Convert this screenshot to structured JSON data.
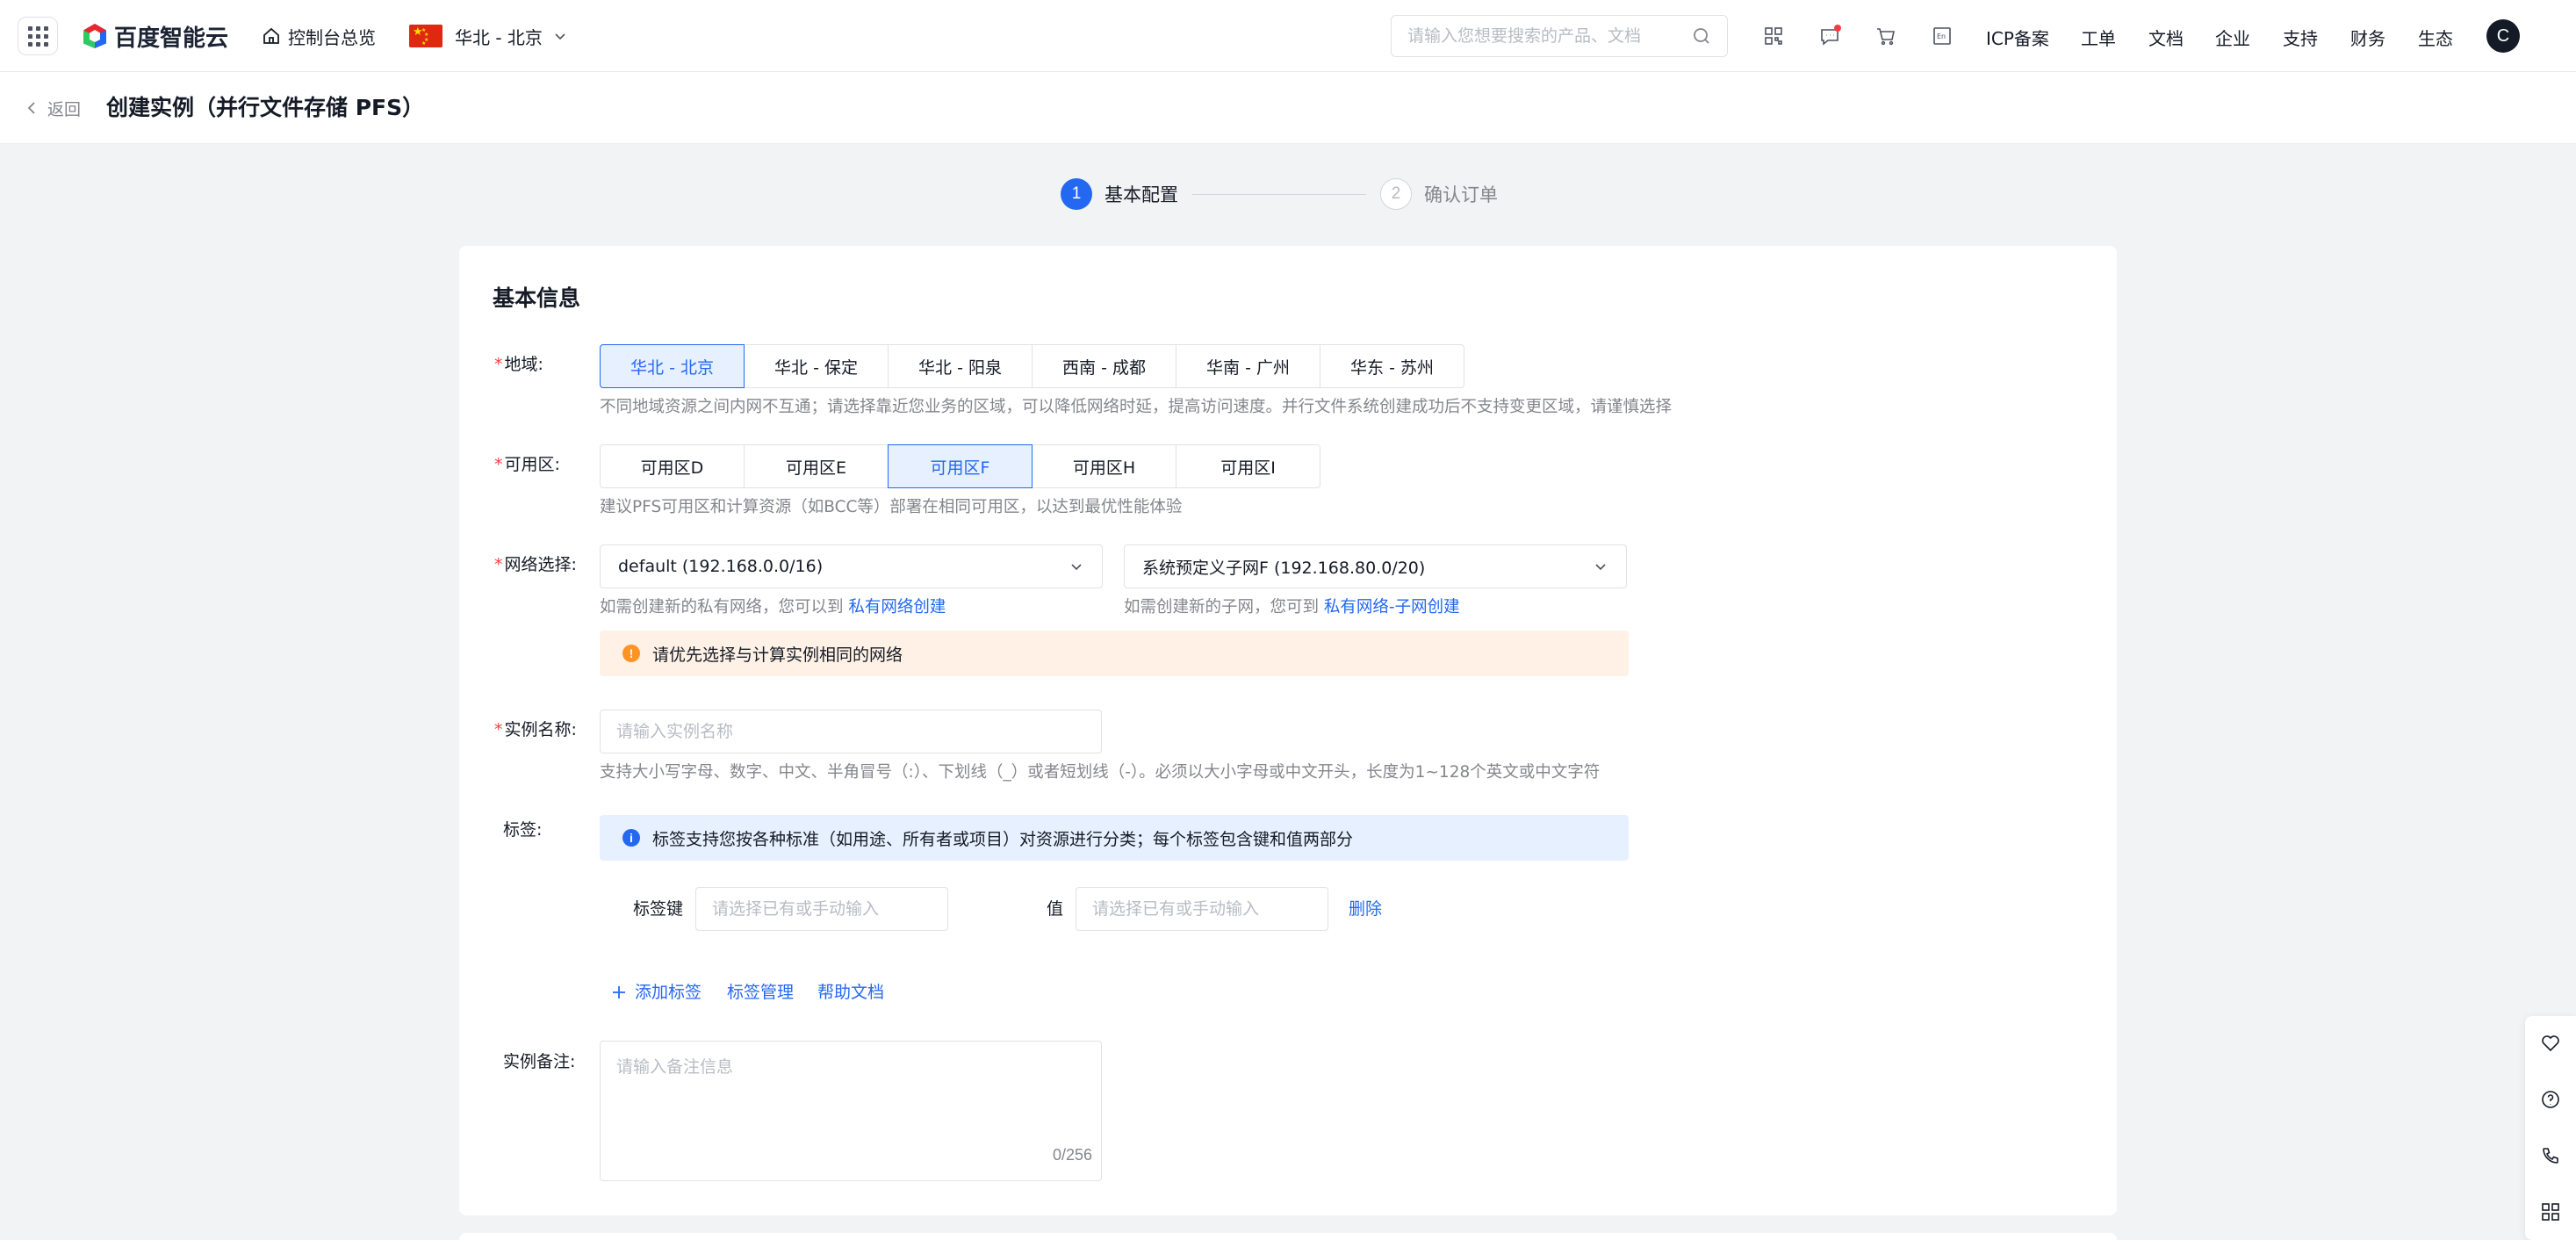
{
  "header": {
    "brand": "百度智能云",
    "console_home": "控制台总览",
    "region": "华北 - 北京",
    "search_placeholder": "请输入您想要搜索的产品、文档",
    "nav": [
      "ICP备案",
      "工单",
      "文档",
      "企业",
      "支持",
      "财务",
      "生态"
    ],
    "avatar_letter": "C"
  },
  "titlebar": {
    "back": "返回",
    "title": "创建实例（并行文件存储 PFS）"
  },
  "steps": [
    {
      "num": "1",
      "label": "基本配置"
    },
    {
      "num": "2",
      "label": "确认订单"
    }
  ],
  "form": {
    "section_title": "基本信息",
    "region": {
      "label": "地域:",
      "options": [
        "华北 - 北京",
        "华北 - 保定",
        "华北 - 阳泉",
        "西南 - 成都",
        "华南 - 广州",
        "华东 - 苏州"
      ],
      "selected": "华北 - 北京",
      "hint": "不同地域资源之间内网不互通；请选择靠近您业务的区域，可以降低网络时延，提高访问速度。并行文件系统创建成功后不支持变更区域，请谨慎选择"
    },
    "zone": {
      "label": "可用区:",
      "options": [
        "可用区D",
        "可用区E",
        "可用区F",
        "可用区H",
        "可用区I"
      ],
      "selected": "可用区F",
      "hint": "建议PFS可用区和计算资源（如BCC等）部署在相同可用区，以达到最优性能体验"
    },
    "network": {
      "label": "网络选择:",
      "vpc_value": "default (192.168.0.0/16)",
      "subnet_value": "系统预定义子网F (192.168.80.0/20)",
      "vpc_hint": "如需创建新的私有网络，您可以到",
      "vpc_link": "私有网络创建",
      "subnet_hint": "如需创建新的子网，您可到",
      "subnet_link": "私有网络-子网创建",
      "warning": "请优先选择与计算实例相同的网络"
    },
    "instance_name": {
      "label": "实例名称:",
      "placeholder": "请输入实例名称",
      "hint": "支持大小写字母、数字、中文、半角冒号（:）、下划线（_）或者短划线（-）。必须以大小字母或中文开头，长度为1~128个英文或中文字符"
    },
    "tags": {
      "label": "标签:",
      "info": "标签支持您按各种标准（如用途、所有者或项目）对资源进行分类；每个标签包含键和值两部分",
      "key_label": "标签键",
      "key_placeholder": "请选择已有或手动输入",
      "value_label": "值",
      "value_placeholder": "请选择已有或手动输入",
      "delete": "删除",
      "add": "添加标签",
      "manage": "标签管理",
      "help": "帮助文档"
    },
    "remark": {
      "label": "实例备注:",
      "placeholder": "请输入备注信息",
      "counter": "0/256"
    }
  },
  "colors": {
    "primary": "#2468f2",
    "warning": "#ff9326",
    "required": "#f33e3e"
  }
}
